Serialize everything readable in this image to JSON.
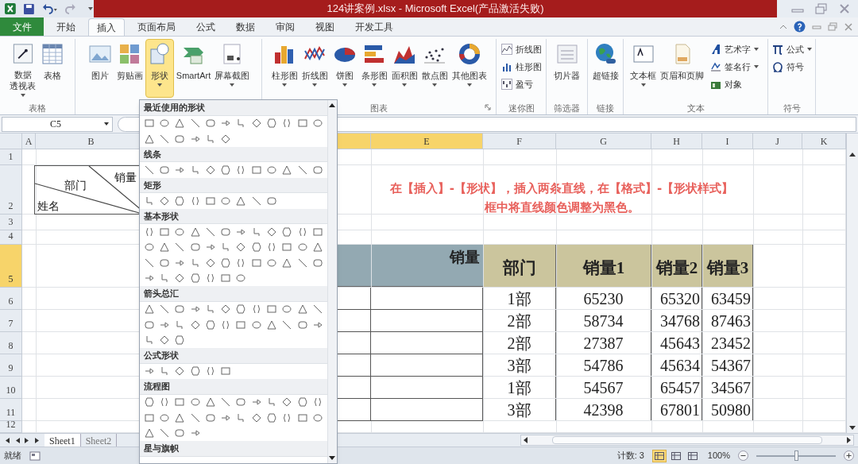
{
  "title_bar": {
    "title": "124讲案例.xlsx - Microsoft Excel(产品激活失败)"
  },
  "ribbon_tabs": [
    {
      "label": "文件",
      "kind": "file",
      "selected": false
    },
    {
      "label": "开始",
      "kind": "tab",
      "selected": false
    },
    {
      "label": "插入",
      "kind": "tab",
      "selected": true
    },
    {
      "label": "页面布局",
      "kind": "tab",
      "selected": false
    },
    {
      "label": "公式",
      "kind": "tab",
      "selected": false
    },
    {
      "label": "数据",
      "kind": "tab",
      "selected": false
    },
    {
      "label": "审阅",
      "kind": "tab",
      "selected": false
    },
    {
      "label": "视图",
      "kind": "tab",
      "selected": false
    },
    {
      "label": "开发工具",
      "kind": "tab",
      "selected": false
    }
  ],
  "ribbon_groups": [
    {
      "label": "表格",
      "launcher": false,
      "buttons": [
        {
          "kind": "large",
          "lines": [
            "数据",
            "透视表"
          ],
          "menu": true,
          "selected": false
        },
        {
          "kind": "large",
          "lines": [
            "表格"
          ],
          "menu": false,
          "selected": false
        }
      ]
    },
    {
      "launcher": false,
      "buttons": [
        {
          "kind": "large",
          "lines": [
            "图片"
          ],
          "menu": false,
          "selected": false
        },
        {
          "kind": "large",
          "lines": [
            "剪贴画"
          ],
          "menu": false,
          "selected": false
        },
        {
          "kind": "large",
          "lines": [
            "形状"
          ],
          "menu": true,
          "selected": true
        },
        {
          "kind": "large",
          "lines": [
            "SmartArt"
          ],
          "menu": false,
          "selected": false
        },
        {
          "kind": "large",
          "lines": [
            "屏幕截图"
          ],
          "menu": true,
          "selected": false
        }
      ]
    },
    {
      "label": "图表",
      "launcher": true,
      "buttons": [
        {
          "kind": "large",
          "lines": [
            "柱形图"
          ],
          "menu": true,
          "selected": false
        },
        {
          "kind": "large",
          "lines": [
            "折线图"
          ],
          "menu": true,
          "selected": false
        },
        {
          "kind": "large",
          "lines": [
            "饼图"
          ],
          "menu": true,
          "selected": false
        },
        {
          "kind": "large",
          "lines": [
            "条形图"
          ],
          "menu": true,
          "selected": false
        },
        {
          "kind": "large",
          "lines": [
            "面积图"
          ],
          "menu": true,
          "selected": false
        },
        {
          "kind": "large",
          "lines": [
            "散点图"
          ],
          "menu": true,
          "selected": false
        },
        {
          "kind": "large",
          "lines": [
            "其他图表"
          ],
          "menu": true,
          "selected": false
        }
      ]
    },
    {
      "label": "迷你图",
      "launcher": false,
      "buttons": [
        {
          "kind": "small",
          "lines": [
            "折线图"
          ],
          "menu": false,
          "selected": false
        },
        {
          "kind": "small",
          "lines": [
            "柱形图"
          ],
          "menu": false,
          "selected": false
        },
        {
          "kind": "small",
          "lines": [
            "盈亏"
          ],
          "menu": false,
          "selected": false
        }
      ]
    },
    {
      "label": "筛选器",
      "launcher": false,
      "buttons": [
        {
          "kind": "large",
          "lines": [
            "切片器"
          ],
          "menu": false,
          "selected": false
        }
      ]
    },
    {
      "label": "链接",
      "launcher": false,
      "buttons": [
        {
          "kind": "large",
          "lines": [
            "超链接"
          ],
          "menu": false,
          "selected": false
        }
      ]
    },
    {
      "label": "文本",
      "launcher": false,
      "buttons": [
        {
          "kind": "large",
          "lines": [
            "文本框"
          ],
          "menu": true,
          "selected": false
        },
        {
          "kind": "large",
          "lines": [
            "页眉和页脚"
          ],
          "menu": false,
          "selected": false
        },
        {
          "kind": "small",
          "lines": [
            "艺术字"
          ],
          "menu": true,
          "selected": false
        },
        {
          "kind": "small",
          "lines": [
            "签名行"
          ],
          "menu": true,
          "selected": false
        },
        {
          "kind": "small",
          "lines": [
            "对象"
          ],
          "menu": false,
          "selected": false
        }
      ]
    },
    {
      "label": "符号",
      "launcher": false,
      "buttons": [
        {
          "kind": "small",
          "lines": [
            "公式"
          ],
          "menu": true,
          "selected": false
        },
        {
          "kind": "small",
          "lines": [
            "符号"
          ],
          "menu": false,
          "selected": false
        }
      ]
    }
  ],
  "formula_bar": {
    "name_box": "C5"
  },
  "shape_gallery": {
    "sections": [
      "最近使用的形状",
      "线条",
      "矩形",
      "基本形状",
      "箭头总汇",
      "公式形状",
      "流程图",
      "星与旗帜"
    ]
  },
  "column_headers": [
    {
      "label": "A",
      "selected": false
    },
    {
      "label": "B",
      "selected": false
    },
    {
      "selected": true
    },
    {
      "label": "E",
      "selected": true
    },
    {
      "label": "F",
      "selected": false
    },
    {
      "label": "G",
      "selected": false
    },
    {
      "label": "H",
      "selected": false
    },
    {
      "label": "I",
      "selected": false
    },
    {
      "label": "J",
      "selected": false
    },
    {
      "label": "K",
      "selected": false
    }
  ],
  "row_headers": [
    {
      "label": "1",
      "selected": false
    },
    {
      "label": "2",
      "selected": false
    },
    {
      "label": "3",
      "selected": false
    },
    {
      "label": "4",
      "selected": false
    },
    {
      "label": "5",
      "selected": true
    },
    {
      "label": "6",
      "selected": false
    },
    {
      "label": "7",
      "selected": false
    },
    {
      "label": "8",
      "selected": false
    },
    {
      "label": "9",
      "selected": false
    },
    {
      "label": "10",
      "selected": false
    },
    {
      "label": "11",
      "selected": false
    },
    {
      "label": "12",
      "selected": false
    }
  ],
  "diagonal_header": {
    "top": "销量",
    "middle": "部门",
    "bottom": "姓名"
  },
  "note": {
    "lines": [
      "在【插入】-【形状】，插入两条直线，在【格式】-【形状样式】",
      "框中将直线颜色调整为黑色。"
    ]
  },
  "table": {
    "merged_header": "销量",
    "columns": [
      "部门",
      "销量1",
      "销量2",
      "销量3"
    ],
    "rows": [
      [
        "1部",
        "65230",
        "65320",
        "63459"
      ],
      [
        "2部",
        "58734",
        "34768",
        "87463"
      ],
      [
        "2部",
        "27387",
        "45643",
        "23452"
      ],
      [
        "3部",
        "54786",
        "45634",
        "54367"
      ],
      [
        "1部",
        "54567",
        "65457",
        "34567"
      ],
      [
        "3部",
        "42398",
        "67801",
        "50980"
      ]
    ]
  },
  "sheet_tabs": [
    {
      "label": "Sheet1",
      "selected": true
    },
    {
      "label": "Sheet2",
      "selected": false
    }
  ],
  "status_bar": {
    "mode": "就绪",
    "count": "计数: 3",
    "view_buttons": [
      {
        "selected": true
      },
      {
        "selected": false
      },
      {
        "selected": false
      }
    ],
    "zoom": {
      "reading": "100%",
      "level": 0.5
    }
  }
}
